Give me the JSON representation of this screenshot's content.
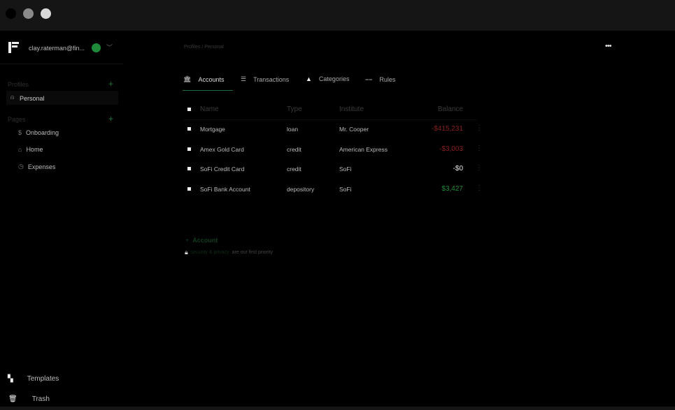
{
  "user": {
    "email": "clay.raterman@fin...",
    "status_color": "#1f8a3a"
  },
  "breadcrumb": {
    "profiles": "Profiles",
    "sep": "/",
    "current": "Personal"
  },
  "sidebar": {
    "profiles_label": "Profiles",
    "profile": "Personal",
    "pages_label": "Pages",
    "pages": [
      {
        "label": "Onboarding",
        "icon": "dollar-icon"
      },
      {
        "label": "Home",
        "icon": "home-icon"
      },
      {
        "label": "Expenses",
        "icon": "clock-icon"
      }
    ],
    "templates": "Templates",
    "trash": "Trash"
  },
  "tabs": [
    {
      "label": "Accounts",
      "active": true
    },
    {
      "label": "Transactions"
    },
    {
      "label": "Categories"
    },
    {
      "label": "Rules"
    }
  ],
  "table": {
    "headers": [
      "Name",
      "Type",
      "Institute",
      "Balance"
    ],
    "rows": [
      {
        "name": "Mortgage",
        "type": "loan",
        "institute": "Mr. Cooper",
        "balance": "-$415,231",
        "color": "#8a1f1f"
      },
      {
        "name": "Amex Gold Card",
        "type": "credit",
        "institute": "American Express",
        "balance": "-$3,003",
        "color": "#8a1f1f"
      },
      {
        "name": "SoFi Credit Card",
        "type": "credit",
        "institute": "SoFi",
        "balance": "-$0",
        "color": "#e6e6e6"
      },
      {
        "name": "SoFi Bank Account",
        "type": "depository",
        "institute": "SoFi",
        "balance": "$3,427",
        "color": "#1f8a3a"
      }
    ]
  },
  "add_account": {
    "plus": "+",
    "label": "Account"
  },
  "privacy": {
    "link": "security & privacy",
    "text": "are our first priority"
  }
}
